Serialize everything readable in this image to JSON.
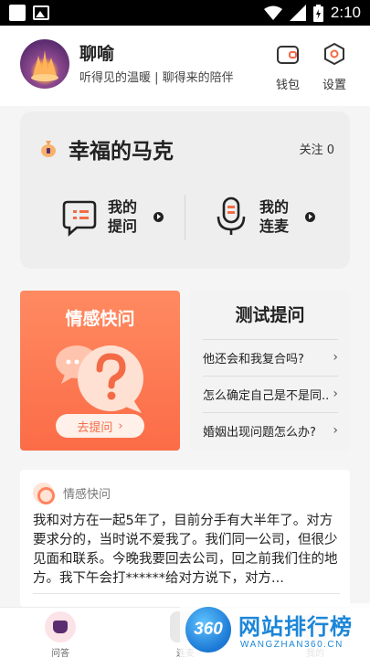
{
  "status_bar": {
    "time": "2:10"
  },
  "header": {
    "app_name": "聊喻",
    "slogan": "听得见的温暖 | 聊得来的陪伴",
    "wallet_label": "钱包",
    "settings_label": "设置"
  },
  "profile_card": {
    "name": "幸福的马克",
    "follow": "关注 0",
    "my_questions": "我的提问",
    "my_mic": "我的连麦"
  },
  "quick_ask": {
    "title": "情感快问",
    "button": "去提问"
  },
  "test_ask": {
    "title": "测试提问",
    "items": [
      "他还会和我复合吗?",
      "怎么确定自己是不是同...",
      "婚姻出现问题怎么办?"
    ]
  },
  "qa_card": {
    "title": "情感快问",
    "text": "我和对方在一起5年了，目前分手有大半年了。对方要求分的，当时说不爱我了。我们同一公司，但很少见面和联系。今晚我要回去公司，回之前我们住的地方。我下午会打******给对方说下，对方..."
  },
  "tab_bar": {
    "tabs": [
      "问答",
      "连麦",
      "我的"
    ]
  },
  "watermark": {
    "logo": "360",
    "name": "网站排行榜",
    "url": "WANGZHAN360.CN"
  },
  "colors": {
    "accent": "#fb6c47",
    "accent_light": "#fff0e9"
  }
}
